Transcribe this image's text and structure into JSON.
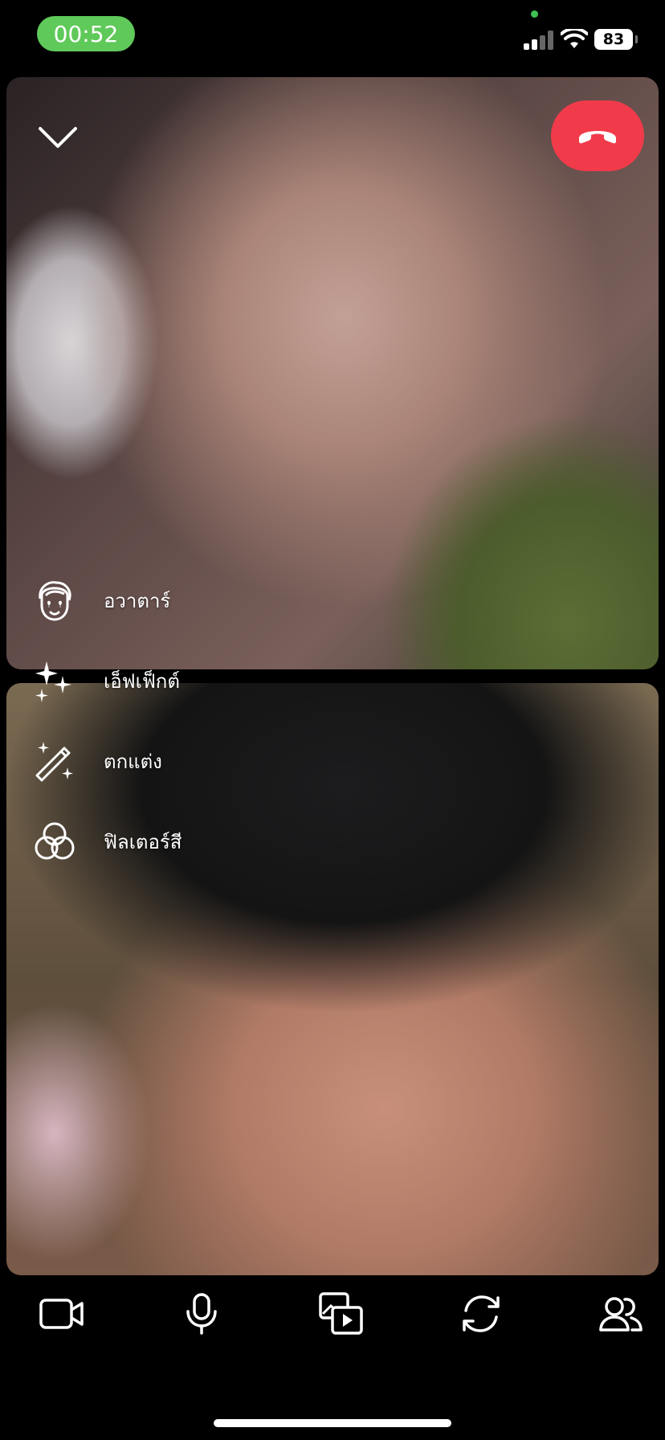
{
  "status_bar": {
    "time": "00:52",
    "battery": "83",
    "colors": {
      "time_pill": "#5fc95a",
      "privacy_dot": "#3fc254"
    }
  },
  "call": {
    "end_call_color": "#f13b4a",
    "icons": {
      "collapse": "chevron-down-icon",
      "end_call": "phone-hangup-icon"
    }
  },
  "effects_menu": {
    "items": [
      {
        "label": "อวาตาร์",
        "icon": "avatar-face-icon"
      },
      {
        "label": "เอ็ฟเฟ็กต์",
        "icon": "sparkles-icon"
      },
      {
        "label": "ตกแต่ง",
        "icon": "magic-wand-icon"
      },
      {
        "label": "ฟิลเตอร์สี",
        "icon": "color-filter-icon"
      }
    ]
  },
  "bottom_bar": {
    "buttons": [
      {
        "icon": "video-camera-icon"
      },
      {
        "icon": "microphone-icon"
      },
      {
        "icon": "share-media-icon"
      },
      {
        "icon": "flip-camera-icon"
      },
      {
        "icon": "participants-icon"
      }
    ]
  }
}
